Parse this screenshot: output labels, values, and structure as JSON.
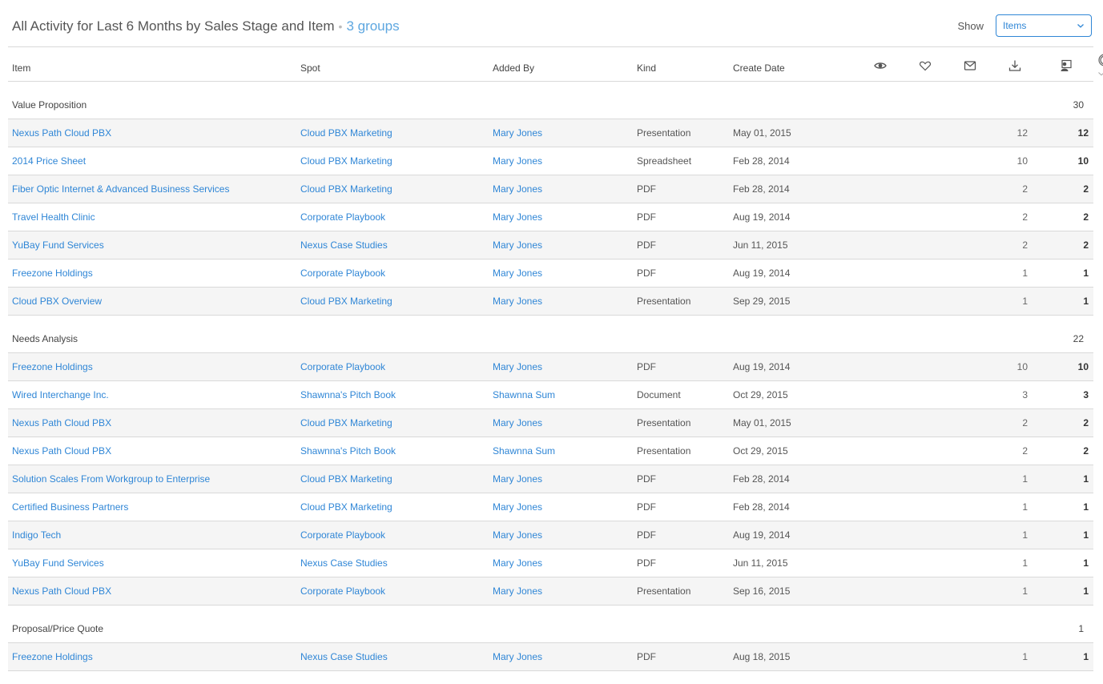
{
  "header": {
    "title": "All Activity for Last 6 Months by Sales Stage and Item",
    "separator": "•",
    "group_count": "3 groups",
    "show_label": "Show",
    "show_select": {
      "value": "Items"
    }
  },
  "columns": {
    "item": "Item",
    "spot": "Spot",
    "added_by": "Added By",
    "kind": "Kind",
    "create_date": "Create Date",
    "icons": [
      "eye-icon",
      "heart-icon",
      "mail-icon",
      "download-icon",
      "presenter-icon",
      "circle-target-icon"
    ]
  },
  "colors": {
    "link": "#2f86d6",
    "accent_light": "#5ea7e0",
    "row_alt_bg": "#f5f5f5",
    "border": "#d9d9d9"
  },
  "groups": [
    {
      "name": "Value Proposition",
      "total_a": "30",
      "total_b": "30",
      "rows": [
        {
          "item": "Nexus Path Cloud PBX",
          "spot": "Cloud PBX Marketing",
          "added_by": "Mary Jones",
          "kind": "Presentation",
          "date": "May 01, 2015",
          "a": "12",
          "b": "12"
        },
        {
          "item": "2014 Price Sheet",
          "spot": "Cloud PBX Marketing",
          "added_by": "Mary Jones",
          "kind": "Spreadsheet",
          "date": "Feb 28, 2014",
          "a": "10",
          "b": "10"
        },
        {
          "item": "Fiber Optic Internet & Advanced Business Services",
          "spot": "Cloud PBX Marketing",
          "added_by": "Mary Jones",
          "kind": "PDF",
          "date": "Feb 28, 2014",
          "a": "2",
          "b": "2"
        },
        {
          "item": "Travel Health Clinic",
          "spot": "Corporate Playbook",
          "added_by": "Mary Jones",
          "kind": "PDF",
          "date": "Aug 19, 2014",
          "a": "2",
          "b": "2"
        },
        {
          "item": "YuBay Fund Services",
          "spot": "Nexus Case Studies",
          "added_by": "Mary Jones",
          "kind": "PDF",
          "date": "Jun 11, 2015",
          "a": "2",
          "b": "2"
        },
        {
          "item": "Freezone Holdings",
          "spot": "Corporate Playbook",
          "added_by": "Mary Jones",
          "kind": "PDF",
          "date": "Aug 19, 2014",
          "a": "1",
          "b": "1"
        },
        {
          "item": "Cloud PBX Overview",
          "spot": "Cloud PBX Marketing",
          "added_by": "Mary Jones",
          "kind": "Presentation",
          "date": "Sep 29, 2015",
          "a": "1",
          "b": "1"
        }
      ]
    },
    {
      "name": "Needs Analysis",
      "total_a": "22",
      "total_b": "22",
      "rows": [
        {
          "item": "Freezone Holdings",
          "spot": "Corporate Playbook",
          "added_by": "Mary Jones",
          "kind": "PDF",
          "date": "Aug 19, 2014",
          "a": "10",
          "b": "10"
        },
        {
          "item": "Wired Interchange Inc.",
          "spot": "Shawnna's Pitch Book",
          "added_by": "Shawnna Sum",
          "kind": "Document",
          "date": "Oct 29, 2015",
          "a": "3",
          "b": "3"
        },
        {
          "item": "Nexus Path Cloud PBX",
          "spot": "Cloud PBX Marketing",
          "added_by": "Mary Jones",
          "kind": "Presentation",
          "date": "May 01, 2015",
          "a": "2",
          "b": "2"
        },
        {
          "item": "Nexus Path Cloud PBX",
          "spot": "Shawnna's Pitch Book",
          "added_by": "Shawnna Sum",
          "kind": "Presentation",
          "date": "Oct 29, 2015",
          "a": "2",
          "b": "2"
        },
        {
          "item": "Solution Scales From Workgroup to Enterprise",
          "spot": "Cloud PBX Marketing",
          "added_by": "Mary Jones",
          "kind": "PDF",
          "date": "Feb 28, 2014",
          "a": "1",
          "b": "1"
        },
        {
          "item": "Certified Business Partners",
          "spot": "Cloud PBX Marketing",
          "added_by": "Mary Jones",
          "kind": "PDF",
          "date": "Feb 28, 2014",
          "a": "1",
          "b": "1"
        },
        {
          "item": "Indigo Tech",
          "spot": "Corporate Playbook",
          "added_by": "Mary Jones",
          "kind": "PDF",
          "date": "Aug 19, 2014",
          "a": "1",
          "b": "1"
        },
        {
          "item": "YuBay Fund Services",
          "spot": "Nexus Case Studies",
          "added_by": "Mary Jones",
          "kind": "PDF",
          "date": "Jun 11, 2015",
          "a": "1",
          "b": "1"
        },
        {
          "item": "Nexus Path Cloud PBX",
          "spot": "Corporate Playbook",
          "added_by": "Mary Jones",
          "kind": "Presentation",
          "date": "Sep 16, 2015",
          "a": "1",
          "b": "1"
        }
      ]
    },
    {
      "name": "Proposal/Price Quote",
      "total_a": "1",
      "total_b": "1",
      "rows": [
        {
          "item": "Freezone Holdings",
          "spot": "Nexus Case Studies",
          "added_by": "Mary Jones",
          "kind": "PDF",
          "date": "Aug 18, 2015",
          "a": "1",
          "b": "1"
        }
      ]
    }
  ]
}
